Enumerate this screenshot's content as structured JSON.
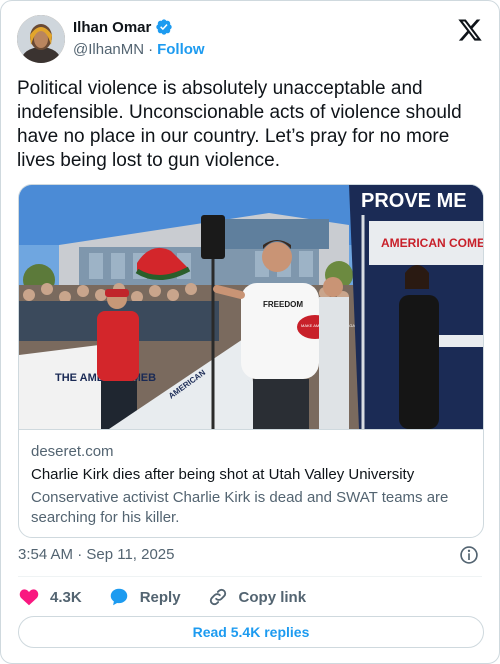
{
  "author": {
    "name": "Ilhan Omar",
    "handle": "@IlhanMN",
    "separator": "·",
    "follow_label": "Follow"
  },
  "tweet": {
    "text": "Political violence is absolutely unacceptable and indefensible. Unconscionable acts of violence should have no place in our country. Let’s pray for no more lives being lost to gun violence."
  },
  "link_card": {
    "domain": "deseret.com",
    "title": "Charlie Kirk dies after being shot at Utah Valley University",
    "description": "Conservative activist Charlie Kirk is dead and SWAT teams are searching for his killer.",
    "photo_text": {
      "tent_banner": "PROVE ME",
      "tent_logo": "AMERICAN COMEBACK",
      "shirt": "FREEDOM",
      "hat": "MAKE AMERICA GREAT AGAIN",
      "left_banner": "THE AMER COMEB",
      "fence": "AMERICAN"
    }
  },
  "meta": {
    "timestamp": "3:54 AM · Sep 11, 2025"
  },
  "actions": {
    "likes": "4.3K",
    "reply_label": "Reply",
    "copy_link_label": "Copy link"
  },
  "read_replies_label": "Read 5.4K replies",
  "colors": {
    "accent": "#1d9bf0",
    "like": "#f91880",
    "text": "#0f1419",
    "secondary": "#536471",
    "border": "#cfd9de"
  },
  "icons": [
    "verified-badge-icon",
    "x-logo-icon",
    "info-icon",
    "heart-icon",
    "reply-bubble-icon",
    "link-icon"
  ]
}
